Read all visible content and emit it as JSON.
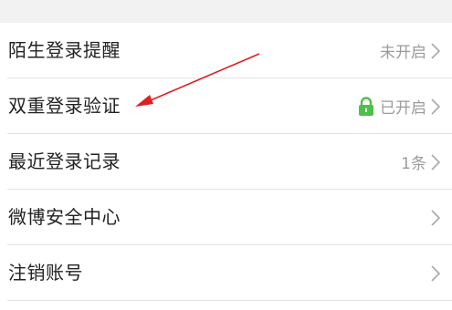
{
  "settings": {
    "items": [
      {
        "label": "陌生登录提醒",
        "value": "未开启",
        "icon": ""
      },
      {
        "label": "双重登录验证",
        "value": "已开启",
        "icon": "lock-icon"
      },
      {
        "label": "最近登录记录",
        "value": "1条",
        "icon": ""
      },
      {
        "label": "微博安全中心",
        "value": "",
        "icon": ""
      },
      {
        "label": "注销账号",
        "value": "",
        "icon": ""
      }
    ]
  },
  "colors": {
    "lock": "#4cc04c",
    "arrow": "#e02020",
    "muted_text": "#9b9b9b",
    "separator": "#e3e3e3",
    "top_gap": "#f2f2f2"
  }
}
